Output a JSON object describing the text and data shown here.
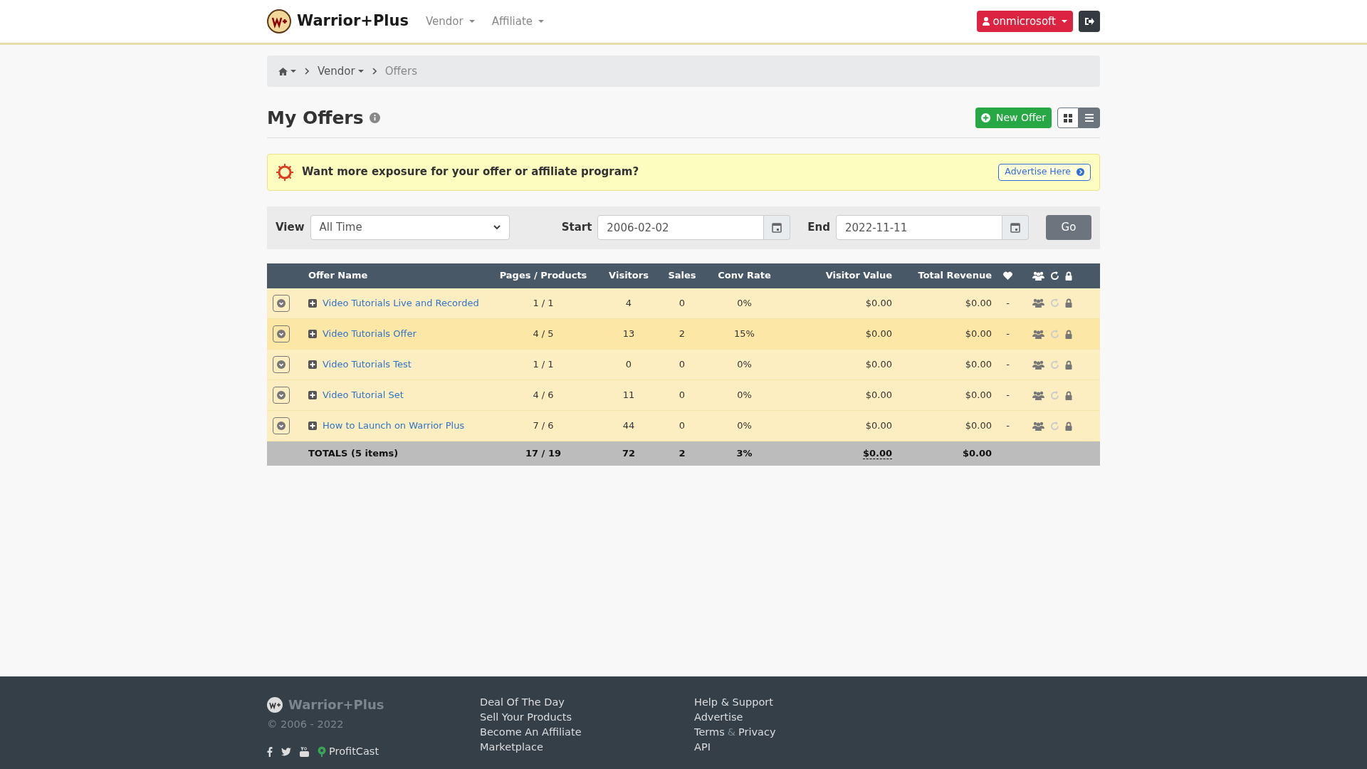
{
  "navbar": {
    "brand": "Warrior+Plus",
    "menus": [
      "Vendor",
      "Affiliate"
    ],
    "user_button": "onmicrosoft"
  },
  "breadcrumb": {
    "items": [
      "Vendor",
      "Offers"
    ]
  },
  "page": {
    "title": "My Offers",
    "new_button": "New Offer",
    "view_toggle": [
      {
        "kind": "grid",
        "selected": false
      },
      {
        "kind": "list",
        "selected": true
      }
    ]
  },
  "banner": {
    "text": "Want more exposure for your offer or affiliate program?",
    "button": "Advertise Here"
  },
  "filters": {
    "view_label": "View",
    "view_value": "All Time",
    "start_label": "Start",
    "start_value": "2006-02-02",
    "end_label": "End",
    "end_value": "2022-11-11",
    "go_button": "Go"
  },
  "table": {
    "columns": [
      "Offer Name",
      "Pages / Products",
      "Visitors",
      "Sales",
      "Conv Rate",
      "Visitor Value",
      "Total Revenue"
    ],
    "rows": [
      {
        "name": "Video Tutorials Live and Recorded",
        "pages_products": "1 / 1",
        "visitors": "4",
        "sales": "0",
        "conv_rate": "0%",
        "visitor_value": "$0.00",
        "total_revenue": "$0.00",
        "favorite": "-",
        "highlighted": false
      },
      {
        "name": "Video Tutorials Offer",
        "pages_products": "4 / 5",
        "visitors": "13",
        "sales": "2",
        "conv_rate": "15%",
        "visitor_value": "$0.00",
        "total_revenue": "$0.00",
        "favorite": "-",
        "highlighted": true
      },
      {
        "name": "Video Tutorials Test",
        "pages_products": "1 / 1",
        "visitors": "0",
        "sales": "0",
        "conv_rate": "0%",
        "visitor_value": "$0.00",
        "total_revenue": "$0.00",
        "favorite": "-",
        "highlighted": false
      },
      {
        "name": "Video Tutorial Set",
        "pages_products": "4 / 6",
        "visitors": "11",
        "sales": "0",
        "conv_rate": "0%",
        "visitor_value": "$0.00",
        "total_revenue": "$0.00",
        "favorite": "-",
        "highlighted": false
      },
      {
        "name": "How to Launch on Warrior Plus",
        "pages_products": "7 / 6",
        "visitors": "44",
        "sales": "0",
        "conv_rate": "0%",
        "visitor_value": "$0.00",
        "total_revenue": "$0.00",
        "favorite": "-",
        "highlighted": false
      }
    ],
    "totals": {
      "label": "TOTALS (5 items)",
      "pages_products": "17 / 19",
      "visitors": "72",
      "sales": "2",
      "conv_rate": "3%",
      "visitor_value": "$0.00",
      "total_revenue": "$0.00"
    }
  },
  "footer": {
    "brand": "Warrior+Plus",
    "copyright": "© 2006 - 2022",
    "podcast": "ProfitCast",
    "links_1": [
      "Deal Of The Day",
      "Sell Your Products",
      "Become An Affiliate",
      "Marketplace"
    ],
    "links_2": [
      [
        {
          "kind": "link",
          "text": "Help & Support"
        }
      ],
      [
        {
          "kind": "link",
          "text": "Advertise"
        }
      ],
      [
        {
          "kind": "link",
          "text": "Terms"
        },
        {
          "kind": "separator",
          "text": "&"
        },
        {
          "kind": "link",
          "text": "Privacy"
        }
      ],
      [
        {
          "kind": "link",
          "text": "API"
        }
      ]
    ]
  }
}
